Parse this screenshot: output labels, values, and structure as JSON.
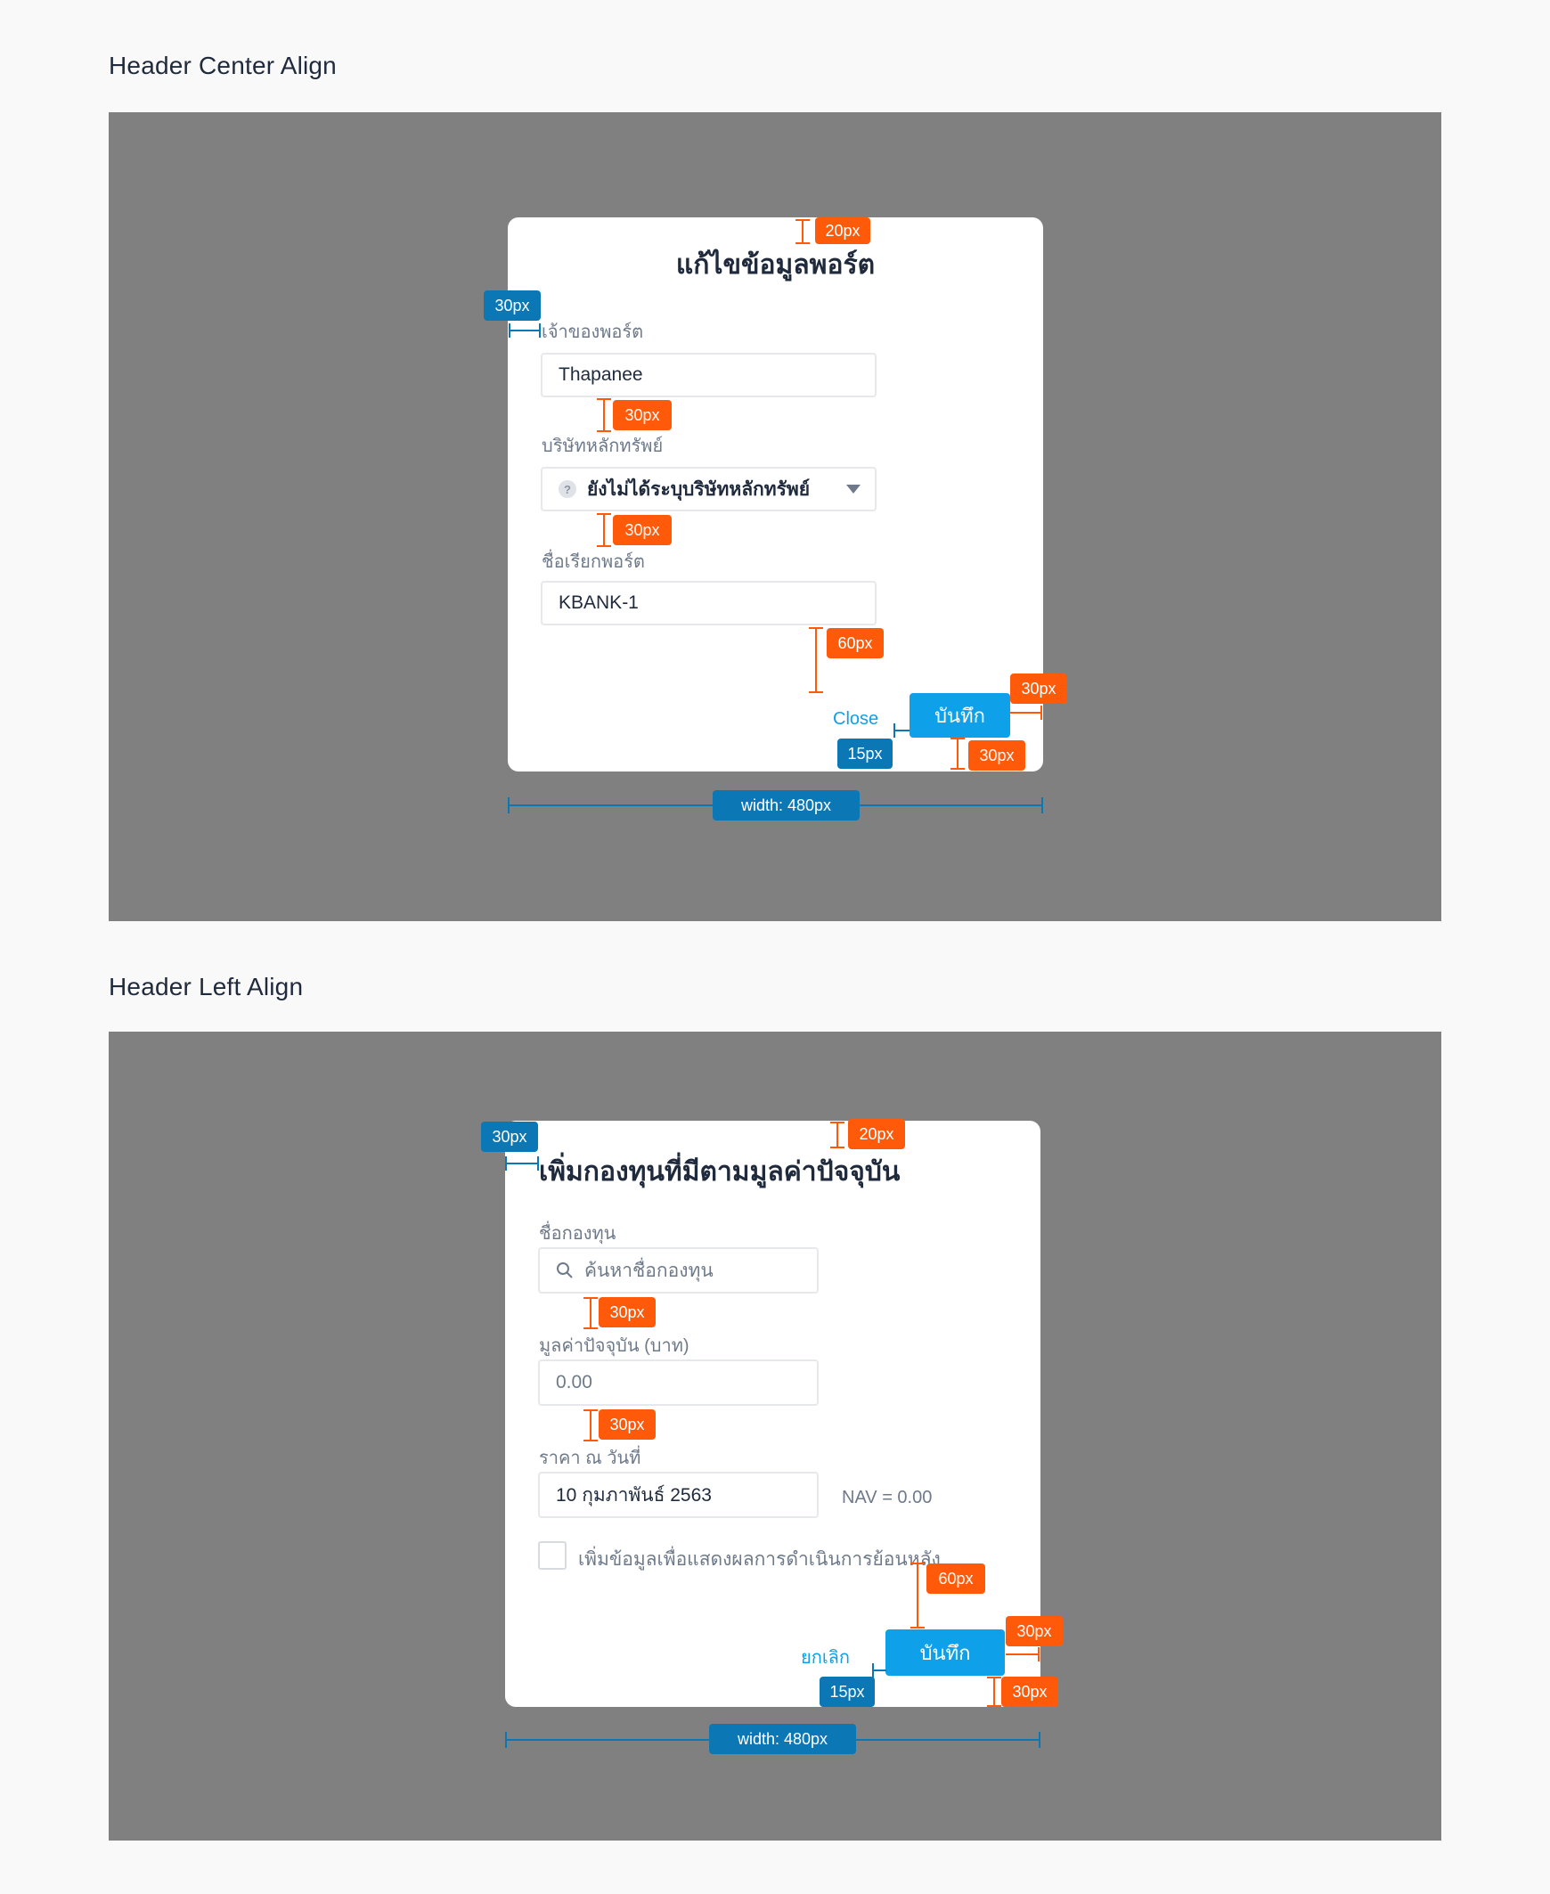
{
  "sections": {
    "center": {
      "title": "Header Center Align"
    },
    "left": {
      "title": "Header Left Align"
    }
  },
  "dialog_center": {
    "title": "แก้ไขข้อมูลพอร์ต",
    "owner_label": "เจ้าของพอร์ต",
    "owner_value": "Thapanee",
    "broker_label": "บริษัทหลักทรัพย์",
    "broker_value": "ยังไม่ได้ระบุบริษัทหลักทรัพย์",
    "broker_help_icon": "?",
    "nickname_label": "ชื่อเรียกพอร์ต",
    "nickname_value": "KBANK-1",
    "close_label": "Close",
    "save_label": "บันทึก"
  },
  "dialog_left": {
    "title": "เพิ่มกองทุนที่มีตามมูลค่าปัจจุบัน",
    "fund_label": "ชื่อกองทุน",
    "fund_placeholder": "ค้นหาชื่อกองทุน",
    "value_label": "มูลค่าปัจจุบัน (บาท)",
    "value_value": "0.00",
    "date_label": "ราคา ณ วันที่",
    "date_value": "10 กุมภาพันธ์ 2563",
    "nav_text": "NAV = 0.00",
    "history_checkbox_label": "เพิ่มข้อมูลเพื่อแสดงผลการดำเนินการย้อนหลัง",
    "cancel_label": "ยกเลิก",
    "save_label": "บันทึก"
  },
  "annotations": {
    "px20": "20px",
    "px30": "30px",
    "px60": "60px",
    "px15": "15px",
    "width": "width: 480px"
  },
  "colors": {
    "stage": "#808080",
    "primary": "#0ea0e8",
    "annotation_orange": "#fe5a0a",
    "annotation_blue": "#0b78b5"
  },
  "icons": [
    "help-icon",
    "caret-down-icon",
    "search-icon"
  ]
}
